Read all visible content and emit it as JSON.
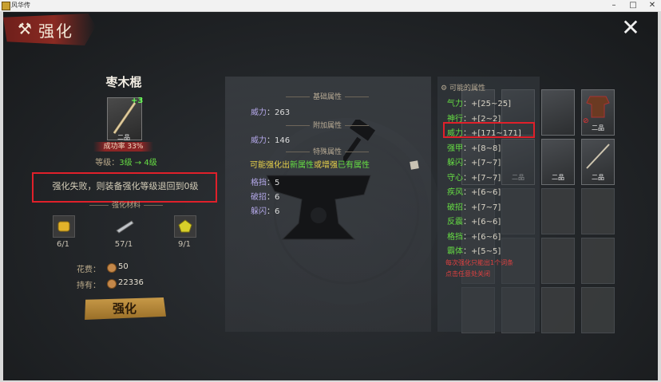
{
  "window": {
    "title": "风华传"
  },
  "header": {
    "title": "强化"
  },
  "item": {
    "name": "枣木棍",
    "plus": "+3",
    "grade": "二品",
    "success_rate": "成功率 33%",
    "level_prefix": "等级：",
    "level_from": "3级",
    "level_arrow": "→",
    "level_to": "4级"
  },
  "warning": "强化失败，则装备强化等级退回到0级",
  "materials": {
    "title": "强化材料",
    "items": [
      {
        "icon": "gold-ore-icon",
        "count": "6/1"
      },
      {
        "icon": "blade-icon",
        "count": "57/1"
      },
      {
        "icon": "yellow-gem-icon",
        "count": "9/1"
      }
    ]
  },
  "cost": {
    "label": "花费：",
    "value": "50"
  },
  "owned": {
    "label": "持有：",
    "value": "22336"
  },
  "enhance_button": "强化",
  "base_attrs": {
    "title": "基础属性",
    "rows": [
      {
        "k": "威力",
        "v": "263"
      }
    ]
  },
  "added_attrs": {
    "title": "附加属性",
    "rows": [
      {
        "k": "威力",
        "v": "146"
      }
    ]
  },
  "special_attrs": {
    "title": "特殊属性",
    "possible_prefix": "可能强化出",
    "possible_new": "新属性",
    "possible_mid": "或增强",
    "possible_existing": "已有属性",
    "rows": [
      {
        "k": "格挡",
        "v": "5"
      },
      {
        "k": "破招",
        "v": "6"
      },
      {
        "k": "躲闪",
        "v": "6"
      }
    ]
  },
  "possible_attrs": {
    "title": "可能的属性",
    "rows": [
      {
        "k": "气力",
        "v": "+[25~25]"
      },
      {
        "k": "神行",
        "v": "+[2~2]"
      },
      {
        "k": "威力",
        "v": "+[171~171]"
      },
      {
        "k": "强甲",
        "v": "+[8~8]"
      },
      {
        "k": "躲闪",
        "v": "+[7~7]"
      },
      {
        "k": "守心",
        "v": "+[7~7]"
      },
      {
        "k": "疾风",
        "v": "+[6~6]"
      },
      {
        "k": "破招",
        "v": "+[7~7]"
      },
      {
        "k": "反震",
        "v": "+[6~6]"
      },
      {
        "k": "格挡",
        "v": "+[6~6]"
      },
      {
        "k": "霸体",
        "v": "+[5~5]"
      }
    ],
    "note_line1": "每次强化只能出1个词条",
    "note_line2": "点击任意处关闭"
  },
  "equipment_slots": {
    "grades": [
      "二品",
      "二品",
      "二品",
      "二品",
      "二品"
    ]
  },
  "colors": {
    "accent_red": "#8a2525",
    "highlight": "#e0202a",
    "green": "#66dd44",
    "gold": "#c89a48"
  }
}
